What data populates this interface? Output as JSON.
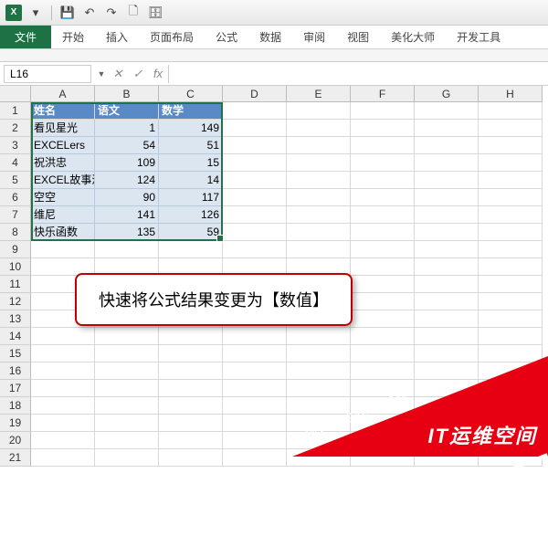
{
  "qat": {
    "dropdown": "▾"
  },
  "tabs": {
    "file": "文件",
    "list": [
      "开始",
      "插入",
      "页面布局",
      "公式",
      "数据",
      "审阅",
      "视图",
      "美化大师",
      "开发工具"
    ]
  },
  "formula_bar": {
    "name_box": "L16",
    "fx": "fx",
    "cancel": "✕",
    "enter": "✓",
    "value": ""
  },
  "cols": [
    "A",
    "B",
    "C",
    "D",
    "E",
    "F",
    "G",
    "H"
  ],
  "rows": [
    "1",
    "2",
    "3",
    "4",
    "5",
    "6",
    "7",
    "8",
    "9",
    "10",
    "11",
    "12",
    "13",
    "14",
    "15",
    "16",
    "17",
    "18",
    "19",
    "20",
    "21"
  ],
  "headers": {
    "A": "姓名",
    "B": "语文",
    "C": "数学"
  },
  "data": [
    {
      "A": "看见星光",
      "B": "1",
      "C": "149"
    },
    {
      "A": "EXCELers",
      "B": "54",
      "C": "51"
    },
    {
      "A": "祝洪忠",
      "B": "109",
      "C": "15"
    },
    {
      "A": "EXCEL故事汇",
      "B": "124",
      "C": "14"
    },
    {
      "A": "空空",
      "B": "90",
      "C": "117"
    },
    {
      "A": "维尼",
      "B": "141",
      "C": "126"
    },
    {
      "A": "快乐函数",
      "B": "135",
      "C": "59"
    }
  ],
  "callout_text": "快速将公式结果变更为【数值】",
  "watermark": {
    "url": "WWW.94IP.COM",
    "brand": "IT运维空间"
  }
}
